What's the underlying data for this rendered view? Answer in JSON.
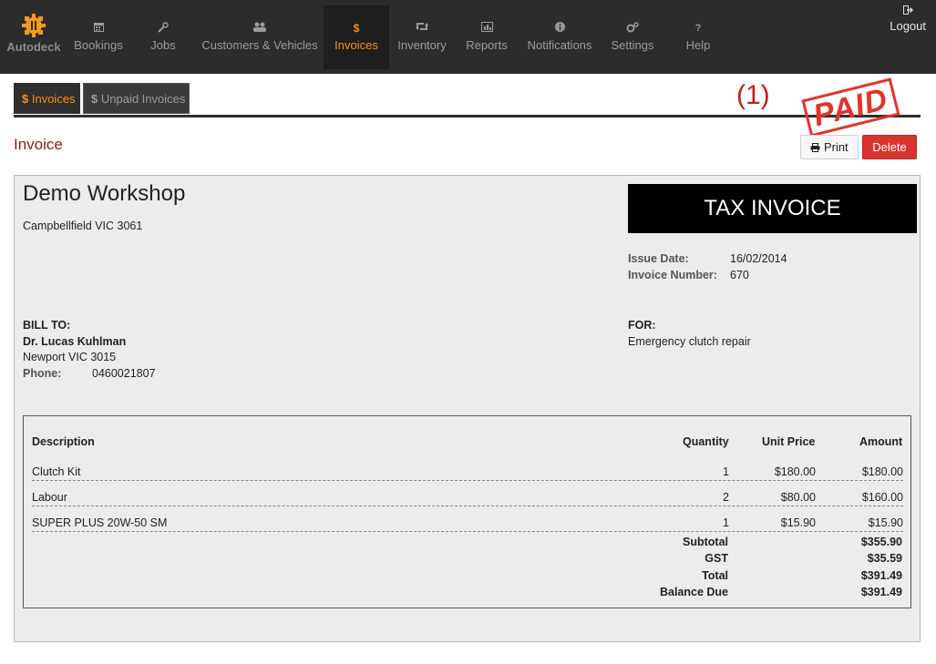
{
  "nav": {
    "brand": "Autodeck",
    "items": [
      {
        "label": "Bookings",
        "icon": "calendar-icon"
      },
      {
        "label": "Jobs",
        "icon": "wrench-icon"
      },
      {
        "label": "Customers & Vehicles",
        "icon": "users-icon"
      },
      {
        "label": "Invoices",
        "icon": "dollar-icon"
      },
      {
        "label": "Inventory",
        "icon": "retweet-icon"
      },
      {
        "label": "Reports",
        "icon": "bar-chart-icon"
      },
      {
        "label": "Notifications",
        "icon": "info-icon"
      },
      {
        "label": "Settings",
        "icon": "cogs-icon"
      },
      {
        "label": "Help",
        "icon": "question-icon"
      }
    ],
    "logout": "Logout",
    "active_color": "#ff8c1a"
  },
  "tabs": {
    "invoices": "Invoices",
    "unpaid": "Unpaid Invoices",
    "dollar": "$"
  },
  "page_count": "(1)",
  "stamp": "PAID",
  "section_title": "Invoice",
  "buttons": {
    "print": "Print",
    "delete": "Delete"
  },
  "invoice": {
    "company": "Demo Workshop",
    "company_address": "Campbellfield VIC 3061",
    "doc_type": "TAX INVOICE",
    "issue_date_label": "Issue Date:",
    "issue_date": "16/02/2014",
    "invoice_number_label": "Invoice Number:",
    "invoice_number": "670",
    "bill_to_label": "BILL TO:",
    "customer_name": "Dr. Lucas Kuhlman",
    "customer_address": "Newport VIC 3015",
    "phone_label": "Phone:",
    "phone": "0460021807",
    "for_label": "FOR:",
    "for_text": "Emergency clutch repair",
    "columns": {
      "description": "Description",
      "quantity": "Quantity",
      "unit_price": "Unit Price",
      "amount": "Amount"
    },
    "lines": [
      {
        "description": "Clutch Kit",
        "quantity": "1",
        "unit_price": "$180.00",
        "amount": "$180.00"
      },
      {
        "description": "Labour",
        "quantity": "2",
        "unit_price": "$80.00",
        "amount": "$160.00"
      },
      {
        "description": "SUPER PLUS 20W-50 SM",
        "quantity": "1",
        "unit_price": "$15.90",
        "amount": "$15.90"
      }
    ],
    "totals": {
      "subtotal_label": "Subtotal",
      "subtotal": "$355.90",
      "gst_label": "GST",
      "gst": "$35.59",
      "total_label": "Total",
      "total": "$391.49",
      "balance_label": "Balance Due",
      "balance": "$391.49"
    }
  }
}
